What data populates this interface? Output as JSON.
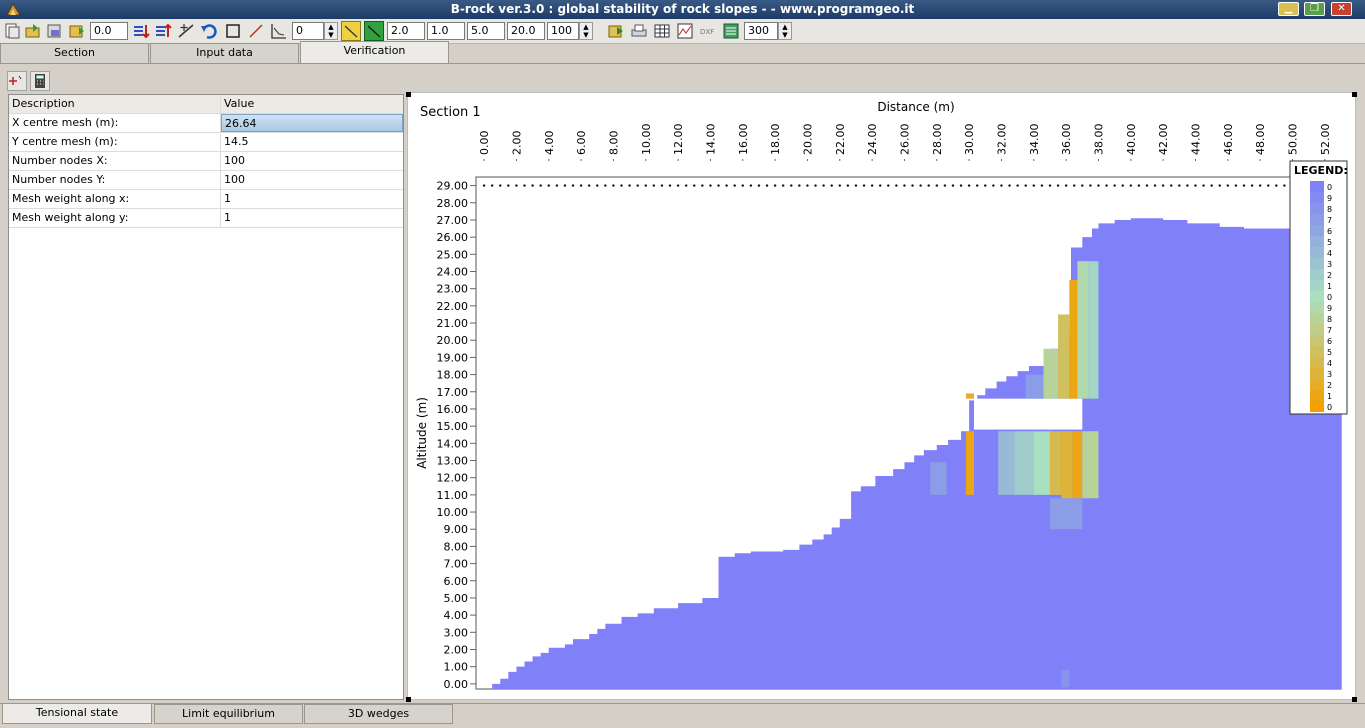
{
  "window": {
    "title": "B-rock ver.3.0 : global stability of rock slopes - - www.programgeo.it"
  },
  "toolbar": {
    "value_offset": "0.0",
    "value_angle": "0",
    "param_1": "2.0",
    "param_2": "1.0",
    "param_3": "5.0",
    "param_4": "20.0",
    "param_5": "100",
    "resolution": "300"
  },
  "tabs": [
    {
      "label": "Section"
    },
    {
      "label": "Input data"
    },
    {
      "label": "Verification"
    }
  ],
  "grid": {
    "headers": {
      "description": "Description",
      "value": "Value"
    },
    "rows": [
      {
        "description": "X centre mesh (m):",
        "value": "26.64"
      },
      {
        "description": "Y centre mesh (m):",
        "value": "14.5"
      },
      {
        "description": "Number nodes X:",
        "value": "100"
      },
      {
        "description": "Number nodes Y:",
        "value": "100"
      },
      {
        "description": "Mesh weight along x:",
        "value": "1"
      },
      {
        "description": "Mesh weight along y:",
        "value": "1"
      }
    ]
  },
  "chart_data": {
    "type": "heatmap",
    "title": "Section 1",
    "xlabel": "Distance (m)",
    "ylabel": "Altitude (m)",
    "xticks": [
      "0.00",
      "2.00",
      "4.00",
      "6.00",
      "8.00",
      "10.00",
      "12.00",
      "14.00",
      "16.00",
      "18.00",
      "20.00",
      "22.00",
      "24.00",
      "26.00",
      "28.00",
      "30.00",
      "32.00",
      "34.00",
      "36.00",
      "38.00",
      "40.00",
      "42.00",
      "44.00",
      "46.00",
      "48.00",
      "50.00",
      "52.00"
    ],
    "yticks": [
      "0.00",
      "1.00",
      "2.00",
      "3.00",
      "4.00",
      "5.00",
      "6.00",
      "7.00",
      "8.00",
      "9.00",
      "10.00",
      "11.00",
      "12.00",
      "13.00",
      "14.00",
      "15.00",
      "16.00",
      "17.00",
      "18.00",
      "19.00",
      "20.00",
      "21.00",
      "22.00",
      "23.00",
      "24.00",
      "25.00",
      "26.00",
      "27.00",
      "28.00",
      "29.00"
    ],
    "xlim": [
      -0.5,
      53
    ],
    "ylim": [
      -0.3,
      29.5
    ],
    "profile_x": [
      0.5,
      1,
      1.5,
      2,
      2.5,
      3,
      3.5,
      4,
      5,
      5.5,
      6.5,
      7,
      7.5,
      8.5,
      9.5,
      10.5,
      12,
      13.5,
      14.5,
      15.5,
      16.5,
      17.5,
      18.5,
      19.5,
      20.3,
      21,
      21.5,
      22,
      22.7,
      23.3,
      24.2,
      25.3,
      26,
      26.6,
      27.2,
      28,
      28.7,
      29.5,
      30,
      30.5,
      31,
      31.7,
      32.3,
      33,
      33.7,
      34.6,
      35,
      35.8,
      36.3,
      37,
      37.6,
      38,
      39,
      40,
      41,
      42,
      43.5,
      44.5,
      45.5,
      47,
      48.5,
      50,
      53
    ],
    "profile_y": [
      0,
      0.3,
      0.7,
      1,
      1.3,
      1.6,
      1.8,
      2.1,
      2.3,
      2.6,
      2.9,
      3.2,
      3.5,
      3.9,
      4.1,
      4.4,
      4.7,
      5.0,
      7.4,
      7.6,
      7.7,
      7.7,
      7.8,
      8.1,
      8.4,
      8.7,
      9.1,
      9.6,
      11.2,
      11.5,
      12.1,
      12.5,
      12.9,
      13.3,
      13.6,
      13.9,
      14.2,
      14.7,
      16.5,
      16.8,
      17.2,
      17.6,
      17.9,
      18.2,
      18.5,
      19.0,
      19.5,
      20.5,
      25.4,
      26.0,
      26.5,
      26.8,
      27.0,
      27.1,
      27.1,
      27.0,
      26.8,
      26.8,
      26.6,
      26.5,
      26.5,
      26.5,
      26.5
    ],
    "gap_band": {
      "x": [
        30.3,
        37.0
      ],
      "y": [
        14.8,
        16.6
      ]
    },
    "colorscale": {
      "low": "#8080f8",
      "mid": "#a8e0c0",
      "high": "#f5a000"
    },
    "colored_cells": [
      {
        "x": [
          27.6,
          28.6
        ],
        "y": [
          11.0,
          12.9
        ],
        "level": 0.15
      },
      {
        "x": [
          29.8,
          30.3
        ],
        "y": [
          11.0,
          14.7
        ],
        "level": 0.95
      },
      {
        "x": [
          29.8,
          30.3
        ],
        "y": [
          16.6,
          16.9
        ],
        "level": 0.9
      },
      {
        "x": [
          31.8,
          32.8
        ],
        "y": [
          11.0,
          14.7
        ],
        "level": 0.3
      },
      {
        "x": [
          32.8,
          34.0
        ],
        "y": [
          11.0,
          14.7
        ],
        "level": 0.4
      },
      {
        "x": [
          34.0,
          35.0
        ],
        "y": [
          11.0,
          14.7
        ],
        "level": 0.5
      },
      {
        "x": [
          35.0,
          35.7
        ],
        "y": [
          11.0,
          14.7
        ],
        "level": 0.8
      },
      {
        "x": [
          35.7,
          36.4
        ],
        "y": [
          10.8,
          14.7
        ],
        "level": 0.85
      },
      {
        "x": [
          36.4,
          37.0
        ],
        "y": [
          10.8,
          14.7
        ],
        "level": 0.95
      },
      {
        "x": [
          37.0,
          38.0
        ],
        "y": [
          10.8,
          14.7
        ],
        "level": 0.6
      },
      {
        "x": [
          35.0,
          37.0
        ],
        "y": [
          9.0,
          10.8
        ],
        "level": 0.15
      },
      {
        "x": [
          33.5,
          34.6
        ],
        "y": [
          16.6,
          18.0
        ],
        "level": 0.15
      },
      {
        "x": [
          34.6,
          35.5
        ],
        "y": [
          16.6,
          19.5
        ],
        "level": 0.6
      },
      {
        "x": [
          35.5,
          36.2
        ],
        "y": [
          16.6,
          21.5
        ],
        "level": 0.75
      },
      {
        "x": [
          36.2,
          36.7
        ],
        "y": [
          16.6,
          23.5
        ],
        "level": 0.95
      },
      {
        "x": [
          36.7,
          37.4
        ],
        "y": [
          16.6,
          24.6
        ],
        "level": 0.55
      },
      {
        "x": [
          37.4,
          38.0
        ],
        "y": [
          16.6,
          24.6
        ],
        "level": 0.45
      },
      {
        "x": [
          35.7,
          36.2
        ],
        "y": [
          -0.2,
          0.8
        ],
        "level": 0.1
      }
    ],
    "legend": {
      "title": "LEGEND:",
      "labels": [
        "0",
        "9",
        "8",
        "7",
        "6",
        "5",
        "4",
        "3",
        "2",
        "1",
        "0",
        "9",
        "8",
        "7",
        "6",
        "5",
        "4",
        "3",
        "2",
        "1",
        "0"
      ]
    }
  },
  "bottom_tabs": [
    {
      "label": "Tensional state"
    },
    {
      "label": "Limit equilibrium"
    },
    {
      "label": "3D wedges"
    }
  ]
}
